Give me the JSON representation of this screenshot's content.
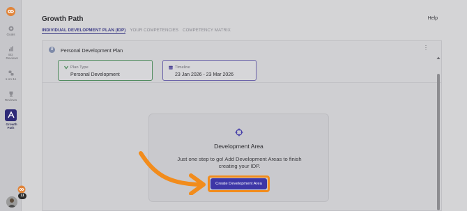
{
  "sidebar": {
    "items": [
      {
        "label": "Goals",
        "icon": "target-icon"
      },
      {
        "label": "Biz Reviews",
        "icon": "chart-icon"
      },
      {
        "label": "1-on-1s",
        "icon": "people-icon"
      },
      {
        "label": "Reviews",
        "icon": "trophy-icon"
      },
      {
        "label": "Growth Path",
        "icon": "growth-path-icon"
      }
    ],
    "notification_count": "11"
  },
  "header": {
    "title": "Growth Path",
    "help": "Help",
    "tabs": [
      {
        "label": "INDIVIDUAL DEVELOPMENT PLAN (IDP)",
        "active": true
      },
      {
        "label": "YOUR COMPETENCIES",
        "active": false
      },
      {
        "label": "COMPETENCY MATRIX",
        "active": false
      }
    ]
  },
  "plan": {
    "avatar_letter": "U",
    "title": "Personal Development Plan",
    "type_label": "Plan Type",
    "type_value": "Personal Development",
    "timeline_label": "Timeline",
    "timeline_value": "23 Jan 2026 - 23 Mar 2026"
  },
  "empty_state": {
    "title": "Development Area",
    "text": "Just one step to go! Add Development Areas to finish creating your IDP.",
    "button": "Create Development Area"
  },
  "colors": {
    "accent": "#3d36a7",
    "highlight": "#f28c1c",
    "plan_type_border": "#4f8b5d",
    "timeline_border": "#6a62a8"
  }
}
